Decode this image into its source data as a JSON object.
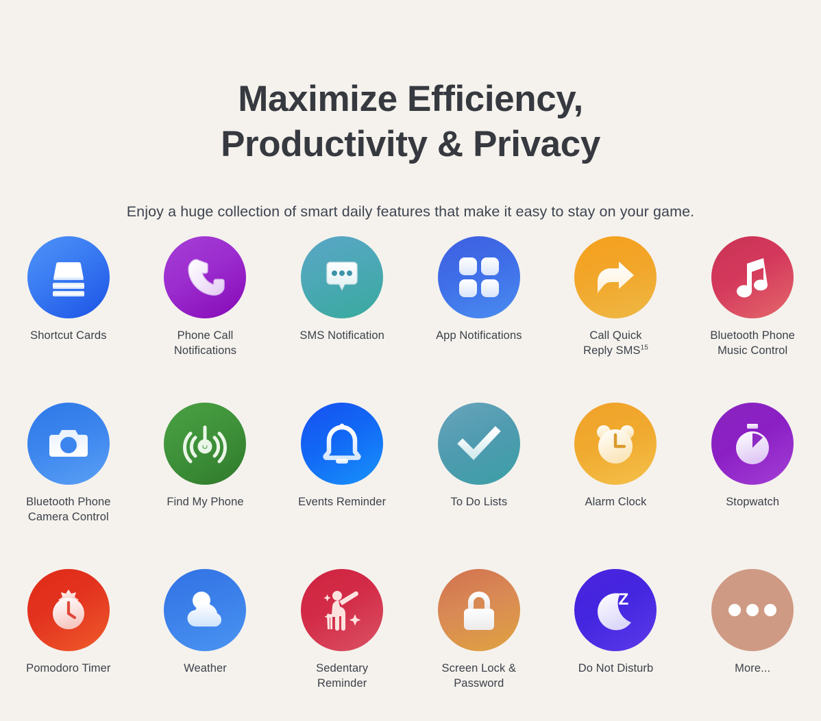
{
  "header": {
    "title_line1": "Maximize Efficiency,",
    "title_line2": "Productivity & Privacy",
    "subtitle": "Enjoy a huge collection of smart daily features that make it easy to stay on your game."
  },
  "colors": {
    "background": "#f5f2ed",
    "title_text": "#36393f",
    "label_text": "#3b4049"
  },
  "features": [
    {
      "label": "Shortcut Cards",
      "icon": "stacked-cards-icon",
      "color_start": "#4f93f7",
      "color_end": "#1c53e6"
    },
    {
      "label": "Phone Call\nNotifications",
      "icon": "phone-handset-icon",
      "color_start": "#a63ed6",
      "color_end": "#8609b6"
    },
    {
      "label": "SMS Notification",
      "icon": "chat-bubble-icon",
      "color_start": "#5aa6c6",
      "color_end": "#39aa9d"
    },
    {
      "label": "App Notifications",
      "icon": "app-grid-icon",
      "color_start": "#3f5fe0",
      "color_end": "#4a8df0"
    },
    {
      "label": "Call Quick\nReply SMS",
      "icon": "reply-arrow-icon",
      "color_start": "#f5a01d",
      "color_end": "#eeb845",
      "superscript": "15"
    },
    {
      "label": "Bluetooth Phone\nMusic Control",
      "icon": "music-note-icon",
      "color_start": "#c93355",
      "color_end": "#e4696b"
    },
    {
      "label": "Bluetooth Phone\nCamera Control",
      "icon": "camera-icon",
      "color_start": "#2e79e8",
      "color_end": "#5aa0f4"
    },
    {
      "label": "Find My Phone",
      "icon": "radar-signal-icon",
      "color_start": "#4ba043",
      "color_end": "#2f7a2c"
    },
    {
      "label": "Events Reminder",
      "icon": "bell-icon",
      "color_start": "#1750f0",
      "color_end": "#1893fb"
    },
    {
      "label": "To Do Lists",
      "icon": "checkmark-icon",
      "color_start": "#69a5bb",
      "color_end": "#3a9fa5"
    },
    {
      "label": "Alarm Clock",
      "icon": "alarm-clock-icon",
      "color_start": "#f0a229",
      "color_end": "#f4c04b"
    },
    {
      "label": "Stopwatch",
      "icon": "stopwatch-icon",
      "color_start": "#8a24c0",
      "color_end": "#a43fd6"
    },
    {
      "label": "Pomodoro Timer",
      "icon": "tomato-timer-icon",
      "color_start": "#e02a18",
      "color_end": "#ef5c2a"
    },
    {
      "label": "Weather",
      "icon": "cloud-sun-icon",
      "color_start": "#3272e4",
      "color_end": "#4a94f1"
    },
    {
      "label": "Sedentary\nReminder",
      "icon": "stretching-person-icon",
      "color_start": "#cf2340",
      "color_end": "#da5365"
    },
    {
      "label": "Screen Lock &\nPassword",
      "icon": "padlock-icon",
      "color_start": "#d2714f",
      "color_end": "#e0a23f"
    },
    {
      "label": "Do Not Disturb",
      "icon": "moon-z-icon",
      "color_start": "#4a22dd",
      "color_end": "#5b3ae8"
    },
    {
      "label": "More...",
      "icon": "ellipsis-icon",
      "color_start": "#cf9a84",
      "color_end": "#cf9a84"
    }
  ]
}
